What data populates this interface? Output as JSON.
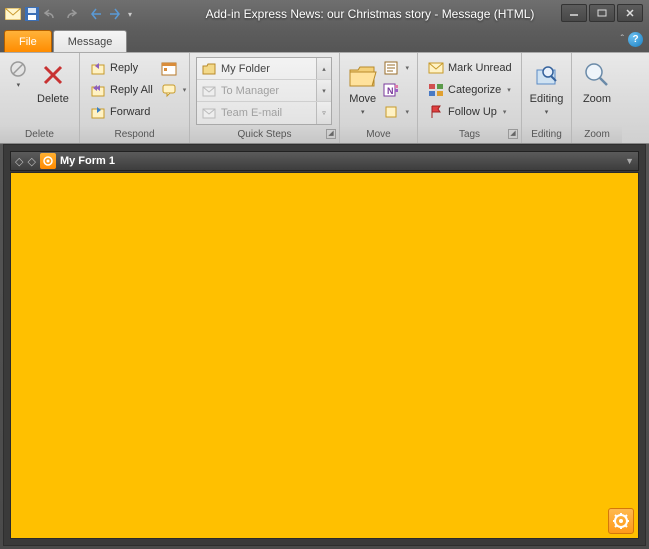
{
  "window": {
    "title": "Add-in Express News: our Christmas story  -  Message (HTML)"
  },
  "tabs": {
    "file": "File",
    "message": "Message"
  },
  "ribbon": {
    "delete": {
      "btn": "Delete",
      "group": "Delete"
    },
    "respond": {
      "reply": "Reply",
      "reply_all": "Reply All",
      "forward": "Forward",
      "group": "Respond"
    },
    "quicksteps": {
      "my_folder": "My Folder",
      "to_manager": "To Manager",
      "team_email": "Team E-mail",
      "group": "Quick Steps"
    },
    "move": {
      "btn": "Move",
      "group": "Move"
    },
    "tags": {
      "mark_unread": "Mark Unread",
      "categorize": "Categorize",
      "follow_up": "Follow Up",
      "group": "Tags"
    },
    "editing": {
      "btn": "Editing",
      "group": "Editing"
    },
    "zoom": {
      "btn": "Zoom",
      "group": "Zoom"
    }
  },
  "form": {
    "title": "My Form 1"
  }
}
